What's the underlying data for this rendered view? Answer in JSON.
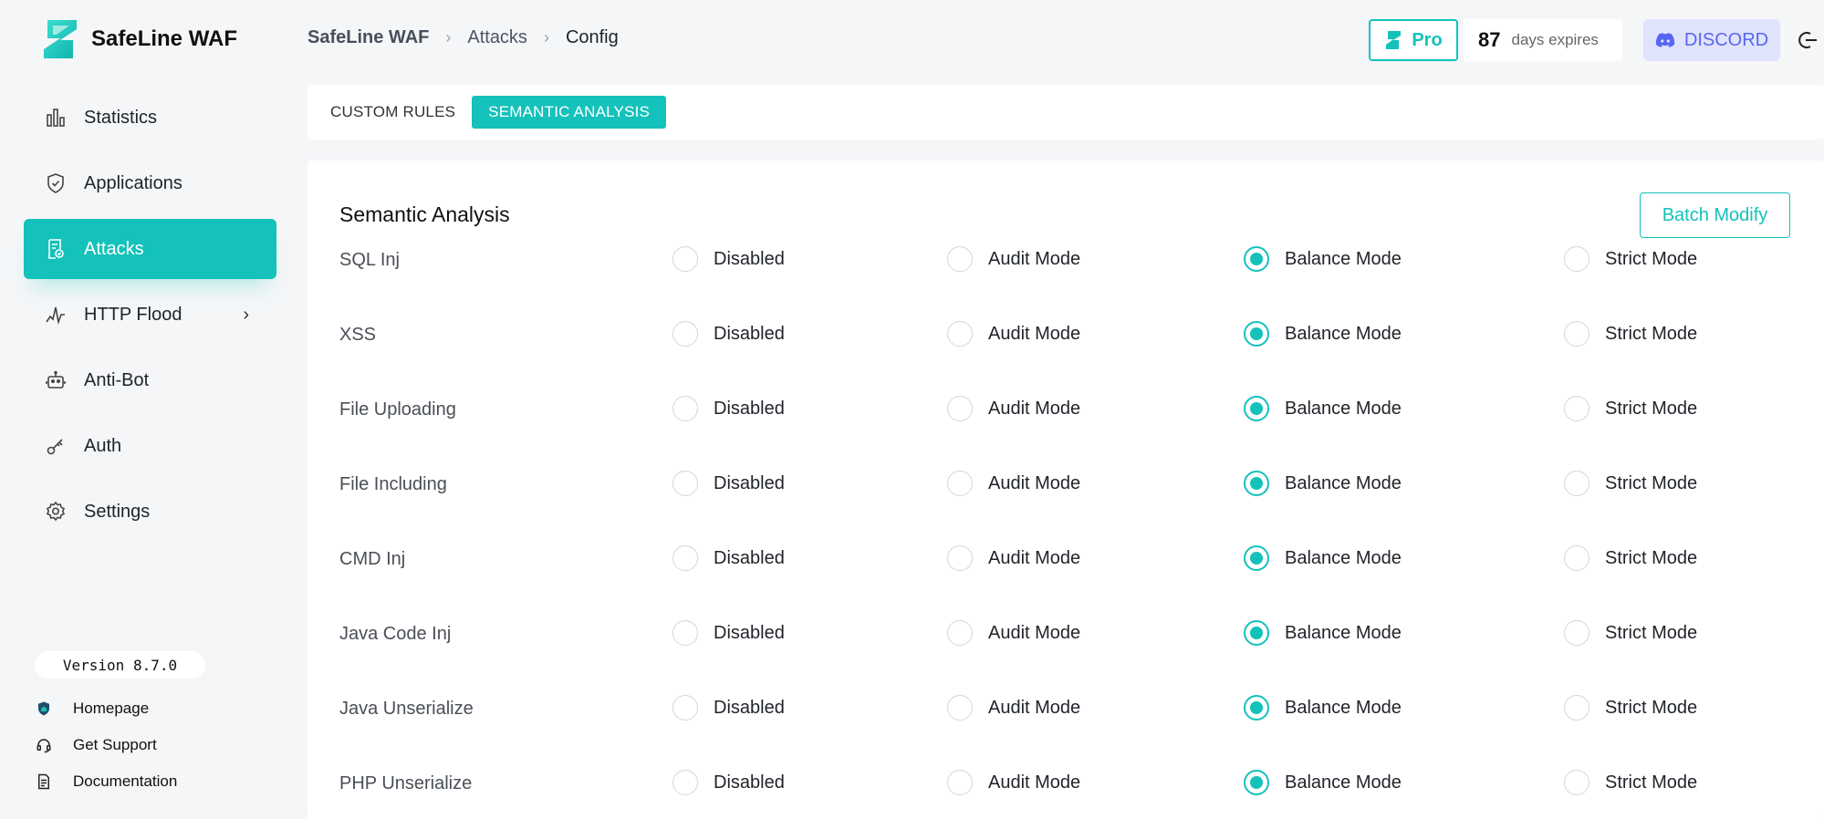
{
  "app": {
    "name": "SafeLine WAF",
    "logo_icon": "safeline-logo-icon"
  },
  "colors": {
    "accent": "#14c2bb",
    "discord": "#5865f2",
    "discord_bg": "#dfe3fb"
  },
  "sidebar": {
    "items": [
      {
        "label": "Statistics",
        "icon": "bar-chart-icon",
        "active": false
      },
      {
        "label": "Applications",
        "icon": "shield-check-icon",
        "active": false
      },
      {
        "label": "Attacks",
        "icon": "report-icon",
        "active": true
      },
      {
        "label": "HTTP Flood",
        "icon": "pulse-icon",
        "active": false,
        "has_submenu": true
      },
      {
        "label": "Anti-Bot",
        "icon": "robot-icon",
        "active": false
      },
      {
        "label": "Auth",
        "icon": "key-icon",
        "active": false
      },
      {
        "label": "Settings",
        "icon": "gear-icon",
        "active": false
      }
    ],
    "version": "Version 8.7.0",
    "links": [
      {
        "label": "Homepage",
        "icon": "shield-home-icon"
      },
      {
        "label": "Get Support",
        "icon": "headset-icon"
      },
      {
        "label": "Documentation",
        "icon": "document-icon"
      }
    ]
  },
  "header": {
    "breadcrumb": [
      "SafeLine WAF",
      "Attacks",
      "Config"
    ],
    "pro_label": "Pro",
    "days_count": "87",
    "days_text": "days expires",
    "discord_label": "DISCORD"
  },
  "tabs": [
    {
      "label": "CUSTOM RULES",
      "active": false
    },
    {
      "label": "SEMANTIC ANALYSIS",
      "active": true
    }
  ],
  "main": {
    "title": "Semantic Analysis",
    "batch_label": "Batch Modify",
    "mode_labels": [
      "Disabled",
      "Audit Mode",
      "Balance Mode",
      "Strict Mode"
    ],
    "rules": [
      {
        "name": "SQL Inj",
        "selected": "Balance Mode"
      },
      {
        "name": "XSS",
        "selected": "Balance Mode"
      },
      {
        "name": "File Uploading",
        "selected": "Balance Mode"
      },
      {
        "name": "File Including",
        "selected": "Balance Mode"
      },
      {
        "name": "CMD Inj",
        "selected": "Balance Mode"
      },
      {
        "name": "Java Code Inj",
        "selected": "Balance Mode"
      },
      {
        "name": "Java Unserialize",
        "selected": "Balance Mode"
      },
      {
        "name": "PHP Unserialize",
        "selected": "Balance Mode"
      }
    ]
  }
}
